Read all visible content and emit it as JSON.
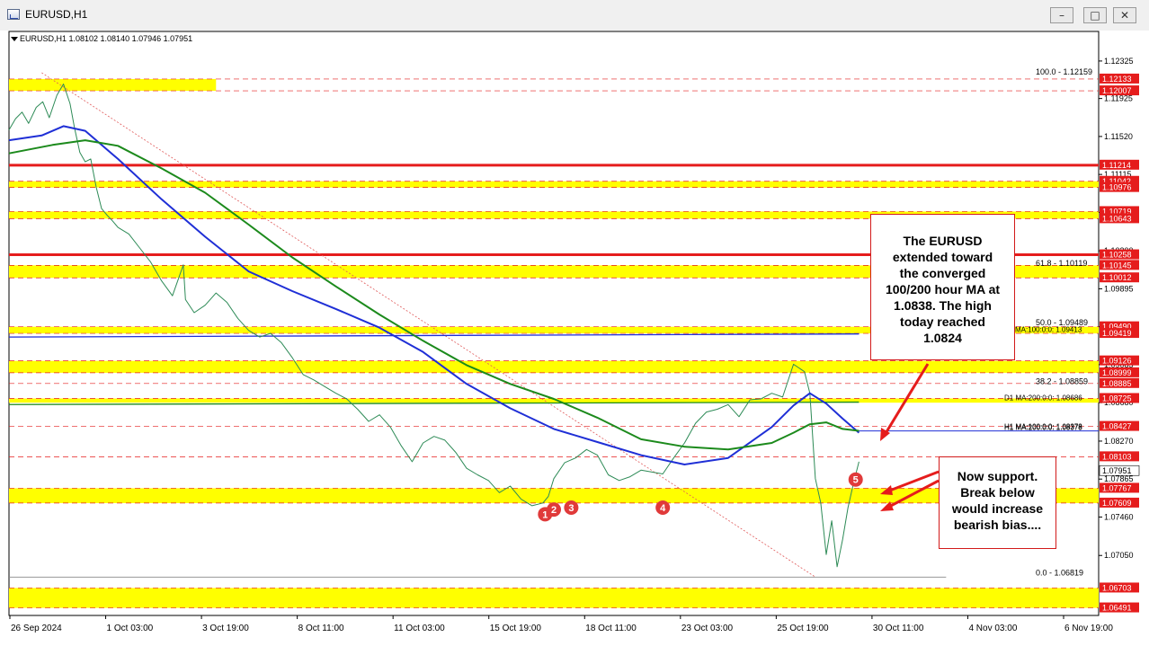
{
  "window": {
    "title": "EURUSD,H1",
    "buttons": {
      "minimize": "–",
      "maximize": "□",
      "close": "✕"
    }
  },
  "ohlc_readout": "EURUSD,H1  1.08102 1.08140 1.07946 1.07951",
  "annotations": {
    "callout_1": [
      "The EURUSD",
      "extended toward",
      "the converged",
      "100/200 hour MA at",
      "1.0838. The high",
      "today reached",
      "1.0824"
    ],
    "callout_2": [
      "Now support.",
      "Break below",
      "would increase",
      "bearish bias...."
    ]
  },
  "colors": {
    "price": "#2e8b57",
    "ma100": "#1f2fd6",
    "ma200": "#1c8a1c",
    "level_red": "#e51c1c",
    "zone_yellow": "#ffff00",
    "tag_red": "#e51c1c",
    "marker_red": "#e03a3a"
  },
  "chart_data": {
    "type": "line",
    "symbol": "EURUSD",
    "timeframe": "H1",
    "x_ticks": [
      "26 Sep 2024",
      "1 Oct 03:00",
      "3 Oct 19:00",
      "8 Oct 11:00",
      "11 Oct 03:00",
      "15 Oct 19:00",
      "18 Oct 11:00",
      "23 Oct 03:00",
      "25 Oct 19:00",
      "30 Oct 11:00",
      "4 Nov 03:00",
      "6 Nov 19:00"
    ],
    "y_ticks": [
      "1.12325",
      "1.11925",
      "1.11520",
      "1.11115",
      "1.10710",
      "1.10300",
      "1.09895",
      "1.09490",
      "1.09085",
      "1.08680",
      "1.08270",
      "1.07865",
      "1.07460",
      "1.07050"
    ],
    "ylim": [
      1.0641,
      1.1265
    ],
    "price_tags": [
      {
        "label": "1.12133",
        "y": 1.12133
      },
      {
        "label": "1.12007",
        "y": 1.12007
      },
      {
        "label": "1.11214",
        "y": 1.11214
      },
      {
        "label": "1.11042",
        "y": 1.11042
      },
      {
        "label": "1.10976",
        "y": 1.10976,
        "partial": true
      },
      {
        "label": "1.10719",
        "y": 1.10719,
        "partial": true
      },
      {
        "label": "1.10643",
        "y": 1.10643
      },
      {
        "label": "1.10258",
        "y": 1.10258
      },
      {
        "label": "1.10145",
        "y": 1.10145
      },
      {
        "label": "1.10012",
        "y": 1.10012
      },
      {
        "label": "1.09490",
        "y": 1.0949
      },
      {
        "label": "1.09419",
        "y": 1.09419,
        "partial": true
      },
      {
        "label": "1.09126",
        "y": 1.09126
      },
      {
        "label": "1.08999",
        "y": 1.08999
      },
      {
        "label": "1.08885",
        "y": 1.08885
      },
      {
        "label": "1.08725",
        "y": 1.08725
      },
      {
        "label": "1.08427",
        "y": 1.08427
      },
      {
        "label": "1.08103",
        "y": 1.08103
      },
      {
        "label": "1.07951",
        "y": 1.07951,
        "current": true
      },
      {
        "label": "1.07767",
        "y": 1.07767
      },
      {
        "label": "1.07609",
        "y": 1.07609
      },
      {
        "label": "1.06703",
        "y": 1.06703
      },
      {
        "label": "1.06491",
        "y": 1.06491
      }
    ],
    "zones": [
      {
        "y1": 1.12133,
        "y2": 1.12007,
        "x_from": 0,
        "x_to": 0.19
      },
      {
        "y1": 1.11042,
        "y2": 1.10976
      },
      {
        "y1": 1.10719,
        "y2": 1.10643
      },
      {
        "y1": 1.10145,
        "y2": 1.10012
      },
      {
        "y1": 1.0949,
        "y2": 1.09419
      },
      {
        "y1": 1.09126,
        "y2": 1.08999
      },
      {
        "y1": 1.08725,
        "y2": 1.0868
      },
      {
        "y1": 1.07767,
        "y2": 1.07609
      },
      {
        "y1": 1.06703,
        "y2": 1.06491
      }
    ],
    "red_lines": [
      1.11214,
      1.10258
    ],
    "dashed_levels": [
      1.12133,
      1.12007,
      1.11214,
      1.11042,
      1.10976,
      1.10719,
      1.10643,
      1.10145,
      1.10012,
      1.0949,
      1.09419,
      1.09126,
      1.08999,
      1.08885,
      1.08725,
      1.08427,
      1.08103,
      1.07767,
      1.07609,
      1.06703,
      1.06491
    ],
    "fib_levels": [
      {
        "label": "100.0 - 1.12159",
        "y": 1.12159
      },
      {
        "label": "61.8 - 1.10119",
        "y": 1.10119
      },
      {
        "label": "50.0 - 1.09489",
        "y": 1.09489
      },
      {
        "label": "38.2 - 1.08859",
        "y": 1.08859
      },
      {
        "label": "0.0 - 1.06819",
        "y": 1.06819
      }
    ],
    "ma_labels": [
      {
        "label": "MA:100:0:0: 1.09413",
        "y": 1.09413
      },
      {
        "label": "D1 MA:200:0:0: 1.08686",
        "y": 1.08686
      },
      {
        "label": "H1 MA:100:0:0: 1.08378",
        "y": 1.08378
      },
      {
        "label": "H1 MA:200:0:0: 1.08378",
        "y": 1.08372
      }
    ],
    "markers": [
      {
        "label": "1",
        "x": 0.492,
        "y": 1.0749
      },
      {
        "label": "2",
        "x": 0.5,
        "y": 1.0754
      },
      {
        "label": "3",
        "x": 0.516,
        "y": 1.0756
      },
      {
        "label": "4",
        "x": 0.6,
        "y": 1.0756
      },
      {
        "label": "5",
        "x": 0.777,
        "y": 1.0786
      }
    ],
    "series": [
      {
        "name": "EURUSD",
        "x": [
          0.0,
          0.006,
          0.012,
          0.018,
          0.025,
          0.031,
          0.037,
          0.044,
          0.05,
          0.056,
          0.06,
          0.065,
          0.07,
          0.075,
          0.08,
          0.085,
          0.09,
          0.095,
          0.1,
          0.11,
          0.12,
          0.13,
          0.14,
          0.15,
          0.16,
          0.162,
          0.17,
          0.18,
          0.19,
          0.2,
          0.21,
          0.22,
          0.23,
          0.24,
          0.25,
          0.26,
          0.27,
          0.28,
          0.29,
          0.3,
          0.31,
          0.32,
          0.33,
          0.34,
          0.35,
          0.36,
          0.37,
          0.38,
          0.39,
          0.4,
          0.41,
          0.42,
          0.43,
          0.44,
          0.45,
          0.46,
          0.47,
          0.48,
          0.49,
          0.495,
          0.5,
          0.51,
          0.52,
          0.53,
          0.54,
          0.55,
          0.56,
          0.57,
          0.58,
          0.59,
          0.6,
          0.61,
          0.62,
          0.63,
          0.64,
          0.65,
          0.66,
          0.67,
          0.68,
          0.69,
          0.7,
          0.71,
          0.72,
          0.73,
          0.735,
          0.74,
          0.745,
          0.75,
          0.755,
          0.76,
          0.765,
          0.77,
          0.775,
          0.78
        ],
        "values": [
          1.1159,
          1.1171,
          1.1178,
          1.1166,
          1.1183,
          1.1189,
          1.1172,
          1.1196,
          1.1208,
          1.1187,
          1.1162,
          1.1135,
          1.1125,
          1.1128,
          1.1098,
          1.1075,
          1.1068,
          1.1062,
          1.1055,
          1.1048,
          1.1033,
          1.1018,
          1.0998,
          1.0982,
          1.1015,
          1.0978,
          1.0964,
          1.0972,
          1.0985,
          1.0975,
          1.0958,
          1.0945,
          1.0938,
          1.0942,
          1.0932,
          1.0916,
          1.0898,
          1.0892,
          1.0885,
          1.0878,
          1.0872,
          1.0861,
          1.0848,
          1.0855,
          1.0842,
          1.0822,
          1.0805,
          1.0825,
          1.0832,
          1.0828,
          1.0815,
          1.0798,
          1.0791,
          1.0785,
          1.0772,
          1.0779,
          1.0765,
          1.0758,
          1.0761,
          1.0768,
          1.0787,
          1.0804,
          1.0809,
          1.0818,
          1.0812,
          1.0791,
          1.0785,
          1.0789,
          1.0796,
          1.0794,
          1.0792,
          1.0809,
          1.0825,
          1.0846,
          1.0858,
          1.0861,
          1.0866,
          1.0853,
          1.0871,
          1.0872,
          1.0878,
          1.0874,
          1.0909,
          1.0901,
          1.0878,
          1.0787,
          1.0761,
          1.0706,
          1.0742,
          1.0693,
          1.0722,
          1.0756,
          1.0782,
          1.0805
        ]
      },
      {
        "name": "MA100",
        "x": [
          0.0,
          0.03,
          0.05,
          0.07,
          0.1,
          0.14,
          0.18,
          0.22,
          0.26,
          0.3,
          0.34,
          0.38,
          0.42,
          0.46,
          0.5,
          0.54,
          0.58,
          0.62,
          0.66,
          0.7,
          0.72,
          0.735,
          0.75,
          0.765,
          0.78
        ],
        "values": [
          1.1148,
          1.1153,
          1.1163,
          1.1158,
          1.1128,
          1.1085,
          1.1045,
          1.1008,
          1.0987,
          1.0968,
          1.0948,
          1.0922,
          1.0888,
          1.0862,
          1.084,
          1.0826,
          1.0812,
          1.0802,
          1.0809,
          1.0842,
          1.0865,
          1.0878,
          1.0867,
          1.0851,
          1.0836
        ]
      },
      {
        "name": "MA200",
        "x": [
          0.0,
          0.04,
          0.07,
          0.1,
          0.14,
          0.18,
          0.22,
          0.26,
          0.3,
          0.34,
          0.38,
          0.42,
          0.46,
          0.5,
          0.54,
          0.58,
          0.62,
          0.66,
          0.7,
          0.72,
          0.735,
          0.75,
          0.765,
          0.78
        ],
        "values": [
          1.1134,
          1.1143,
          1.1148,
          1.1142,
          1.1118,
          1.1092,
          1.1058,
          1.1023,
          1.0992,
          1.0962,
          1.0934,
          1.0908,
          1.0888,
          1.0872,
          1.0852,
          1.0829,
          1.0821,
          1.0818,
          1.0825,
          1.0836,
          1.0845,
          1.0847,
          1.084,
          1.0838
        ]
      }
    ],
    "long_ma_lines": [
      {
        "name": "MA:100",
        "y_start": 1.0938,
        "y_end": 1.09413
      },
      {
        "name": "D1 MA:200",
        "y_start": 1.0866,
        "y_end": 1.08686
      }
    ],
    "trendline": {
      "from": {
        "x": 0.03,
        "y": 1.122
      },
      "to": {
        "x": 0.74,
        "y": 1.0682
      }
    },
    "fib_range_line": {
      "from": {
        "x": 0.0,
        "y": 1.06819
      },
      "to": {
        "x": 0.86,
        "y": 1.06819
      }
    }
  }
}
